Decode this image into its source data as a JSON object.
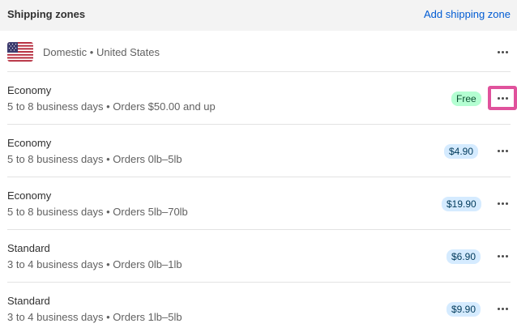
{
  "header": {
    "title": "Shipping zones",
    "add_link": "Add shipping zone"
  },
  "zone": {
    "flag_icon": "us-flag-icon",
    "name": "Domestic • United States"
  },
  "rates": [
    {
      "name": "Economy",
      "description": "5 to 8 business days • Orders $50.00 and up",
      "price": "Free",
      "badge_color": "#b4fed2"
    },
    {
      "name": "Economy",
      "description": "5 to 8 business days • Orders 0lb–5lb",
      "price": "$4.90",
      "badge_color": "#d5ebff"
    },
    {
      "name": "Economy",
      "description": "5 to 8 business days • Orders 5lb–70lb",
      "price": "$19.90",
      "badge_color": "#d5ebff"
    },
    {
      "name": "Standard",
      "description": "3 to 4 business days • Orders 0lb–1lb",
      "price": "$6.90",
      "badge_color": "#d5ebff"
    },
    {
      "name": "Standard",
      "description": "3 to 4 business days • Orders 1lb–5lb",
      "price": "$9.90",
      "badge_color": "#d5ebff"
    }
  ],
  "colors": {
    "link": "#005bd3",
    "highlight": "#e0529c"
  }
}
